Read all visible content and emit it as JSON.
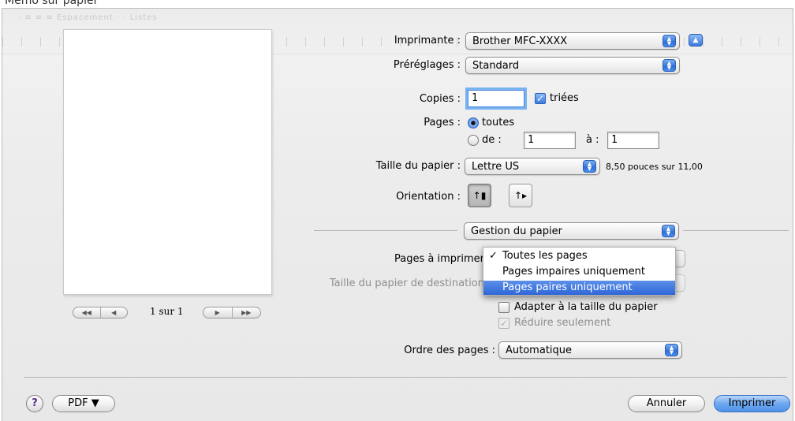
{
  "caption_top": "Mémo sur papier",
  "ruler_hint": "· ≡ ≡ ≡ Espacement · · Listes",
  "preview": {
    "nav_first": "◀◀",
    "nav_prev": "◀",
    "nav_next": "▶",
    "nav_last": "▶▶",
    "page_count": "1 sur 1"
  },
  "printer": {
    "label": "Imprimante :",
    "value": "Brother MFC-XXXX",
    "disclosure": "▲"
  },
  "presets": {
    "label": "Préréglages :",
    "value": "Standard"
  },
  "copies": {
    "label": "Copies :",
    "value": "1",
    "collate_label": "triées",
    "collate_checked": true
  },
  "pages": {
    "label": "Pages :",
    "all_label": "toutes",
    "from_label": "de :",
    "from_value": "1",
    "to_label": "à :",
    "to_value": "1"
  },
  "paper_size": {
    "label": "Taille du papier :",
    "value": "Lettre US",
    "dimensions": "8,50 pouces sur 11,00"
  },
  "orientation": {
    "label": "Orientation :",
    "portrait": "↑▮",
    "landscape": "↑▸"
  },
  "section_popup": "Gestion du papier",
  "pages_to_print": {
    "label": "Pages à imprimer",
    "menu_items": [
      "Toutes les pages",
      "Pages impaires uniquement",
      "Pages paires uniquement"
    ],
    "checked_item": "Toutes les pages",
    "highlighted_item": "Pages paires uniquement"
  },
  "destination_size": {
    "label": "Taille du papier de destination"
  },
  "scale_to_fit": {
    "label": "Adapter à la taille du papier"
  },
  "scale_down_only": {
    "label": "Réduire seulement"
  },
  "page_order": {
    "label": "Ordre des pages :",
    "value": "Automatique"
  },
  "bottom": {
    "help": "?",
    "pdf": "PDF ▼",
    "cancel": "Annuler",
    "print": "Imprimer"
  }
}
